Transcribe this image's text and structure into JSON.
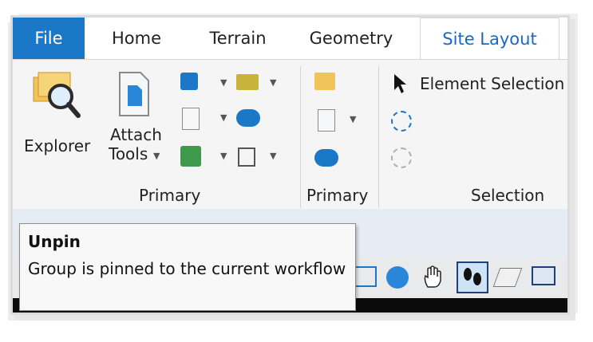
{
  "tabs": [
    {
      "label": "File"
    },
    {
      "label": "Home"
    },
    {
      "label": "Terrain"
    },
    {
      "label": "Geometry"
    },
    {
      "label": "Site Layout"
    }
  ],
  "active_tab": "Site Layout",
  "ribbon": {
    "explorer_label": "Explorer",
    "attach_tools_line1": "Attach",
    "attach_tools_line2": "Tools",
    "group1_label": "Primary",
    "group2_label": "Primary",
    "group3_label": "Selection",
    "element_selection_label": "Element Selection"
  },
  "tooltip": {
    "title": "Unpin",
    "body": "Group is pinned to the current workflow"
  },
  "icons": {
    "explorer": "folder-magnifier-icon",
    "attach": "document-icon",
    "pin": "pin-icon",
    "cursor": "mouse-pointer-icon",
    "element_selection": "arrow-cursor-icon",
    "hand": "hand-pan-icon",
    "footprints": "footprints-icon"
  },
  "colors": {
    "file_tab": "#1b78c8",
    "active_tab_text": "#1769c4",
    "highlight_box": "#e8302b"
  }
}
